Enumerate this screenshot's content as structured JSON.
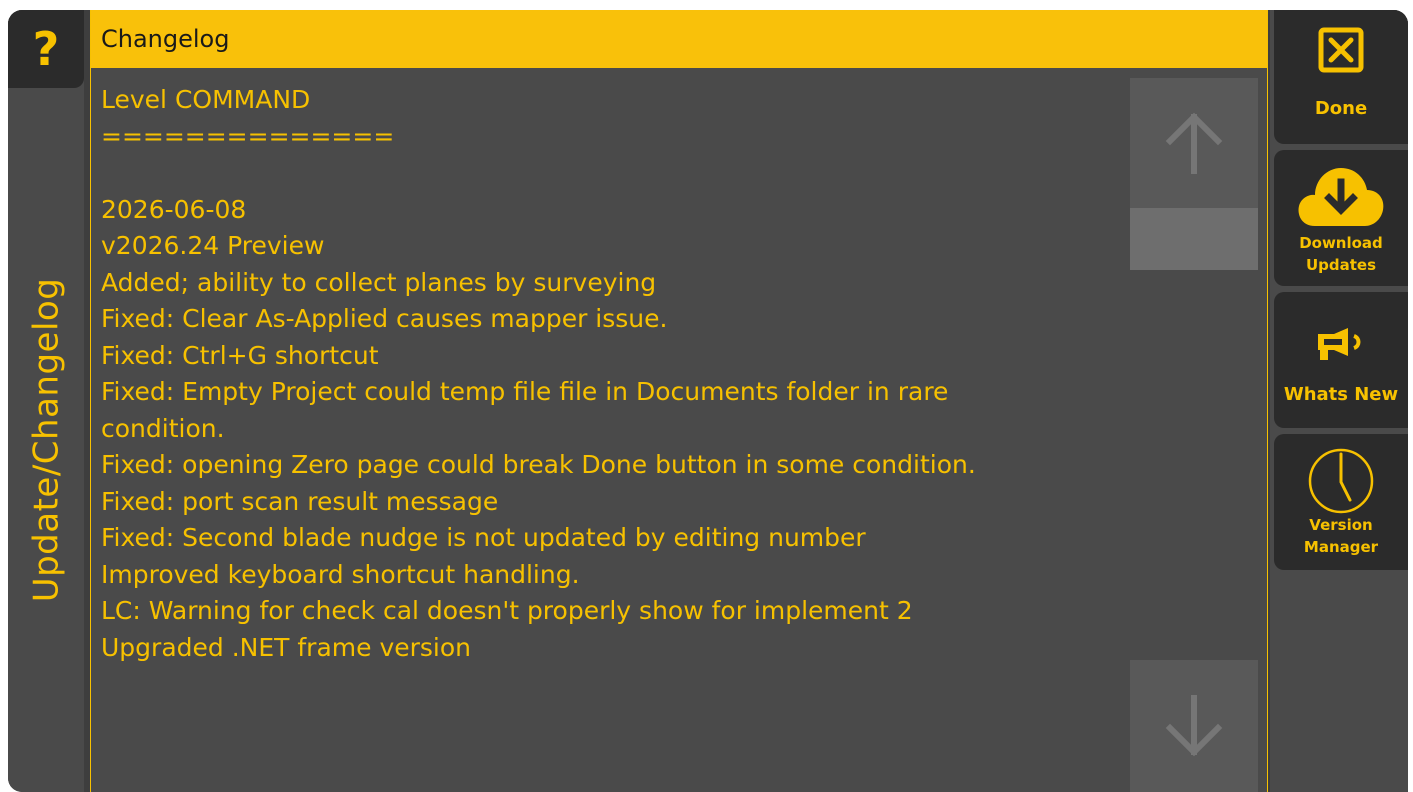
{
  "help": {
    "glyph": "?"
  },
  "rail": {
    "title": "Update/Changelog"
  },
  "panel": {
    "header": "Changelog",
    "lines": [
      "Level COMMAND",
      "==============",
      "",
      "2026-06-08",
      "v2026.24 Preview",
      "Added; ability to collect planes by surveying",
      "Fixed: Clear As-Applied causes mapper issue.",
      "Fixed: Ctrl+G shortcut",
      "Fixed: Empty Project could temp file file in Documents folder in rare",
      "condition.",
      "Fixed: opening Zero page could break Done button in some condition.",
      "Fixed: port scan result message",
      "Fixed: Second blade nudge is not updated by editing number",
      "Improved keyboard shortcut handling.",
      "LC: Warning for check cal doesn't properly show for implement 2",
      "Upgraded .NET frame version"
    ]
  },
  "sidebar": {
    "done_label": "Done",
    "download_label_1": "Download",
    "download_label_2": "Updates",
    "whatsnew_label": "Whats New",
    "version_label_1": "Version",
    "version_label_2": "Manager"
  },
  "colors": {
    "accent": "#f7c100",
    "header_bg": "#f9c10a",
    "panel_bg": "#4a4a4a",
    "button_bg": "#2b2b2b"
  },
  "icons": [
    "question-icon",
    "arrow-up-icon",
    "arrow-down-icon",
    "close-box-icon",
    "cloud-download-icon",
    "megaphone-icon",
    "clock-icon"
  ]
}
